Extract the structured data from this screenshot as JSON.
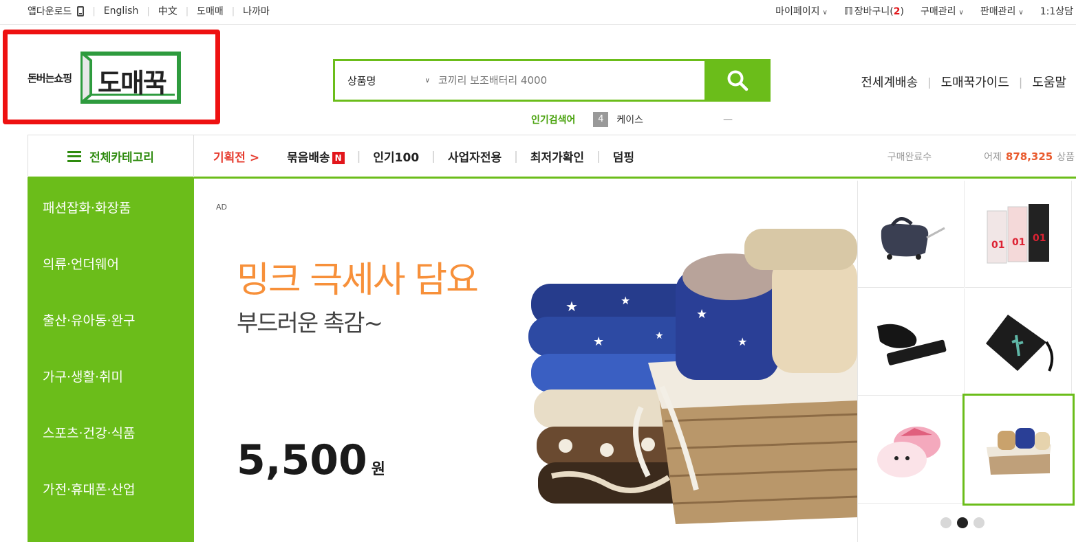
{
  "topbar": {
    "left": [
      "앱다운로드",
      "English",
      "中文",
      "도매매",
      "나까마"
    ],
    "mypage": "마이페이지",
    "cart_label": "장바구니(",
    "cart_count": "2",
    "cart_close": ")",
    "purchase": "구매관리",
    "sales": "판매관리",
    "support": "1:1상담"
  },
  "logo": {
    "sub": "돈버는쇼핑",
    "main": "도매꾹"
  },
  "search": {
    "select": "상품명",
    "placeholder": "코끼리 보조배터리 4000"
  },
  "header_links": [
    "전세계배송",
    "도매꾹가이드",
    "도움말"
  ],
  "popular": {
    "label": "인기검색어",
    "rank": "4",
    "term": "케이스",
    "toggle": "—"
  },
  "nav": {
    "all_categories": "전체카테고리",
    "special": "기획전 >",
    "items": [
      "묶음배송",
      "인기100",
      "사업자전용",
      "최저가확인",
      "덤핑"
    ],
    "new_badge": "N",
    "stats_label": "구매완료수",
    "stats_day": "어제",
    "stats_count": "878,325",
    "stats_unit": "상품"
  },
  "sidebar": {
    "items": [
      "패션잡화·화장품",
      "의류·언더웨어",
      "출산·유아동·완구",
      "가구·생활·취미",
      "스포츠·건강·식품",
      "가전·휴대폰·산업"
    ]
  },
  "hero": {
    "ad": "AD",
    "title": "밍크 극세사 담요",
    "subtitle": "부드러운 촉감~",
    "price": "5,500",
    "unit": "원"
  },
  "grid": {
    "products": [
      "travel-bag",
      "earphones",
      "phone-holder",
      "pouch",
      "slippers",
      "blanket-basket"
    ],
    "active_index": 5,
    "pages": 3,
    "active_page": 2
  },
  "colors": {
    "brand_green": "#6bbd1a",
    "hero_orange": "#f7903a",
    "highlight_red": "#ee1111"
  }
}
